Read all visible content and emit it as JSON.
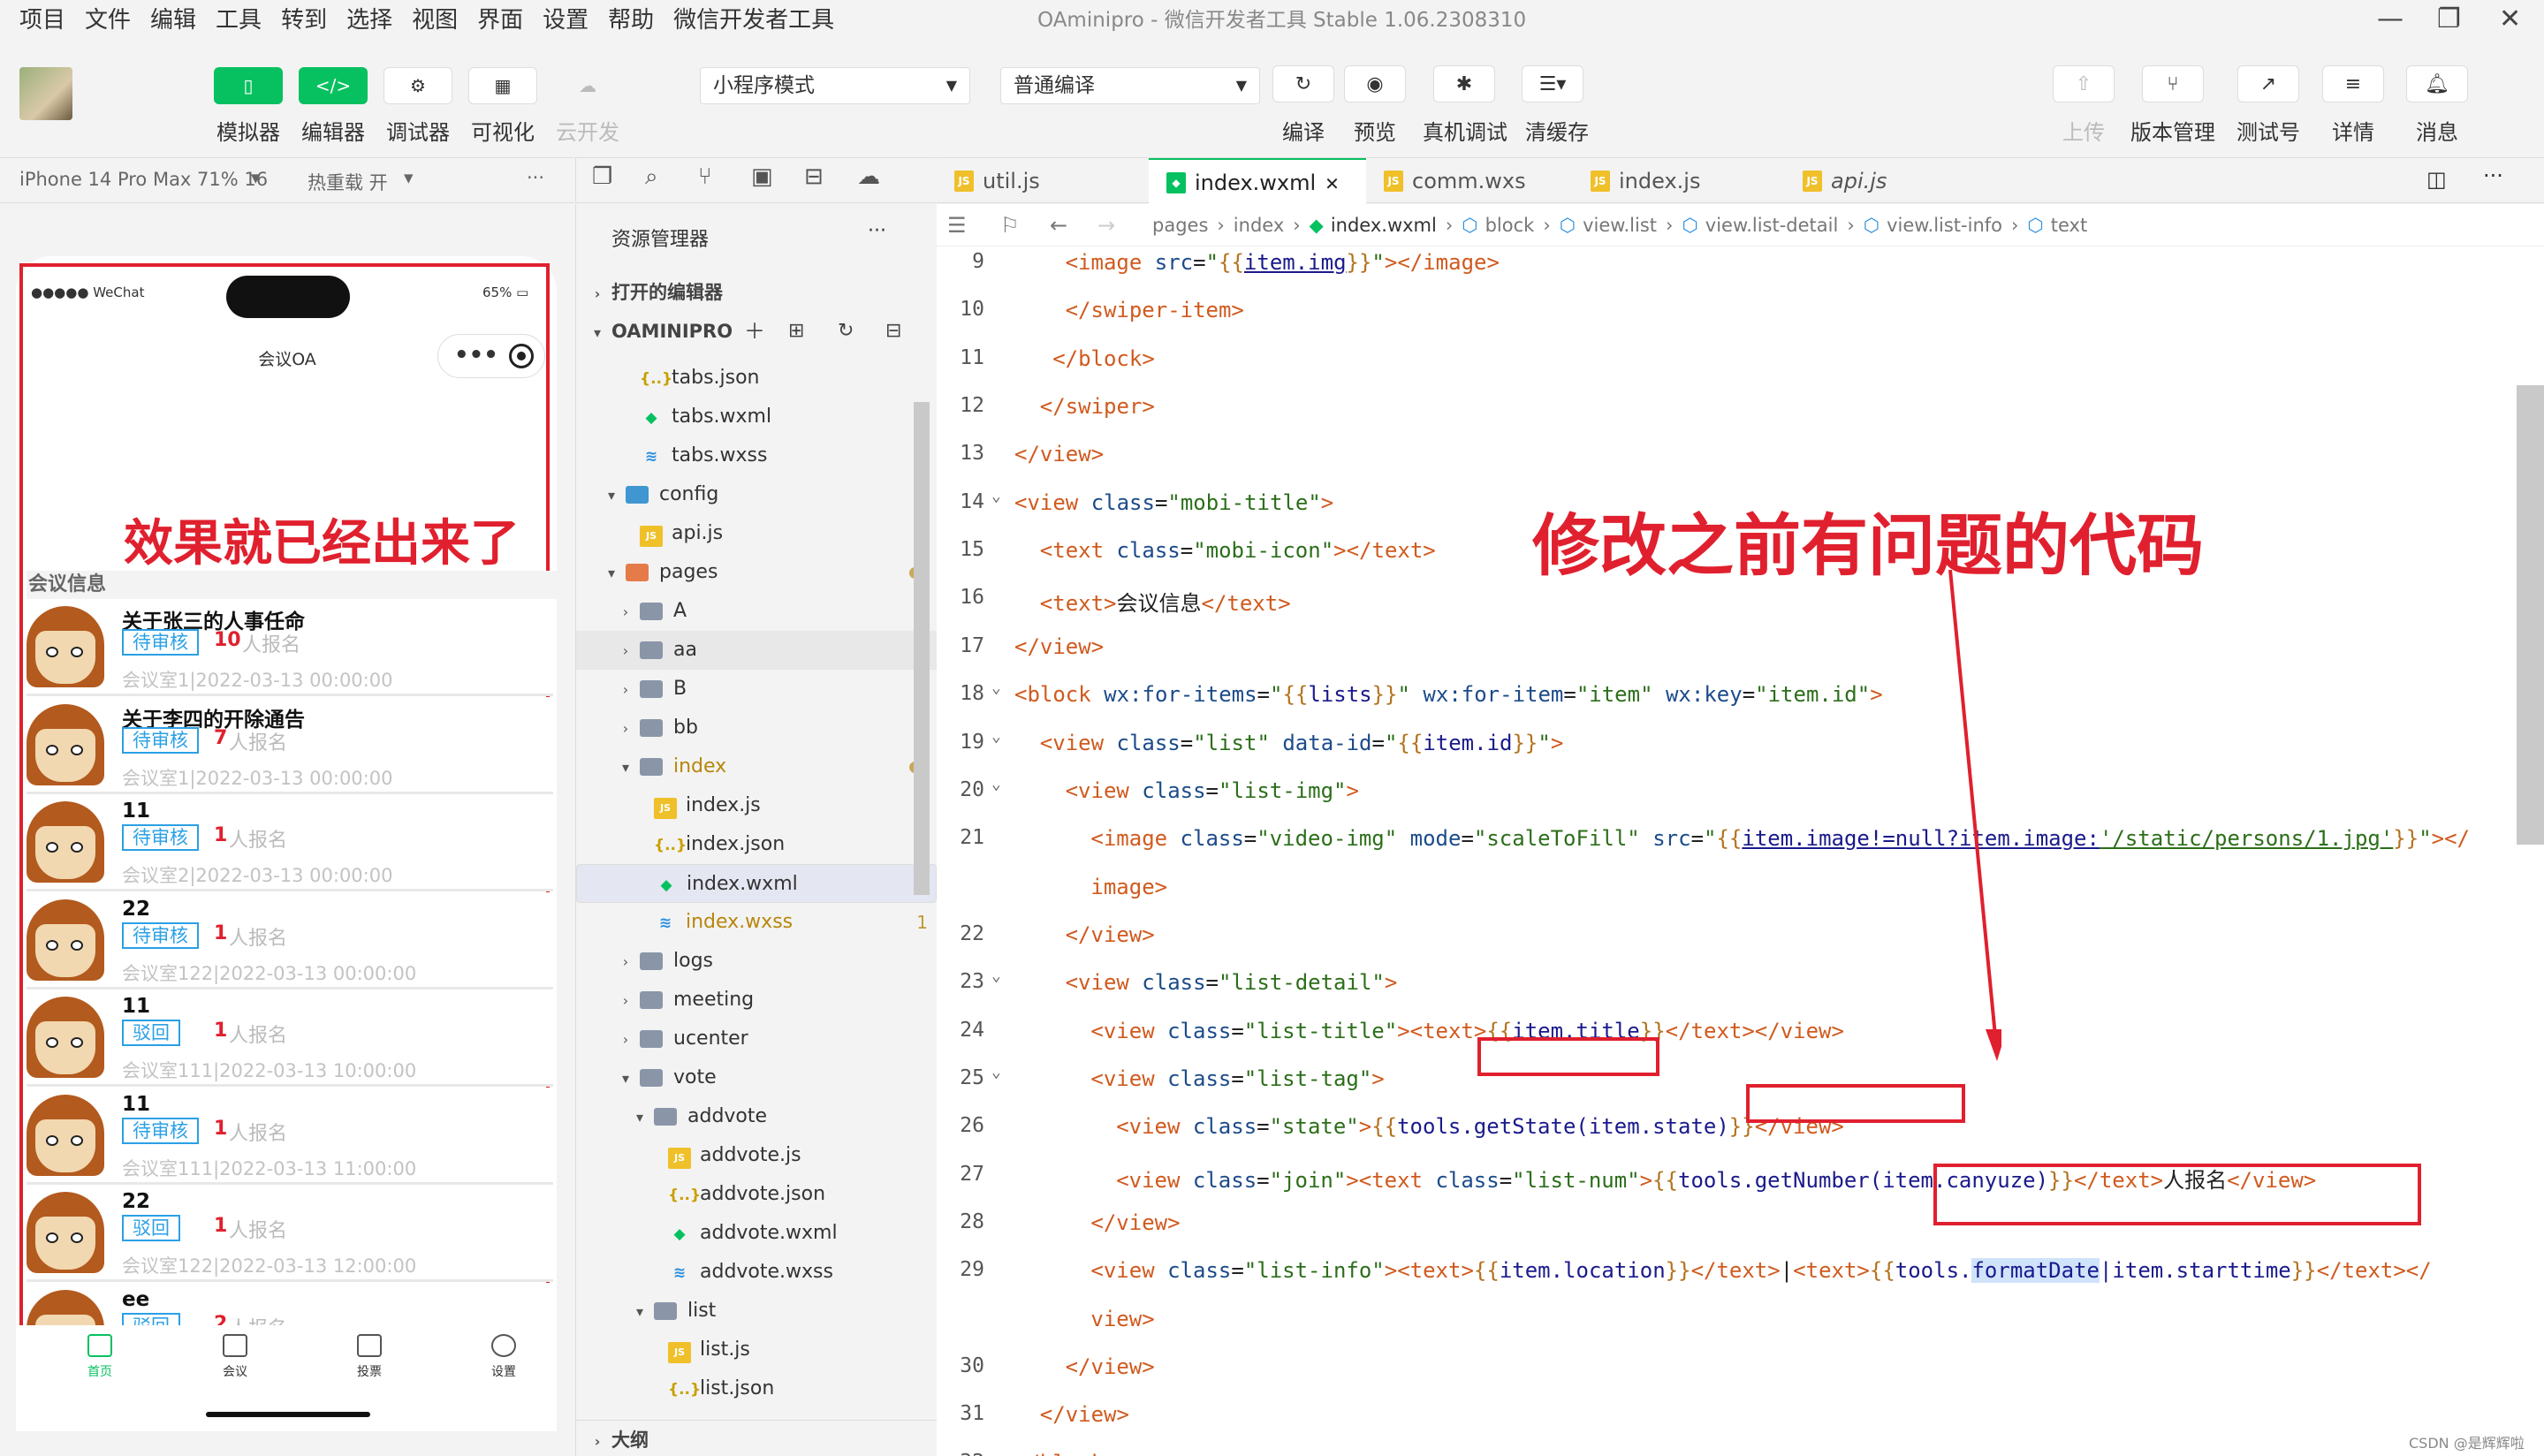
{
  "menu": [
    "项目",
    "文件",
    "编辑",
    "工具",
    "转到",
    "选择",
    "视图",
    "界面",
    "设置",
    "帮助",
    "微信开发者工具"
  ],
  "window_title": "OAminipro - 微信开发者工具 Stable 1.06.2308310",
  "toolbar": {
    "left": [
      {
        "label": "模拟器",
        "icon": "phone-icon"
      },
      {
        "label": "编辑器",
        "icon": "code-icon"
      },
      {
        "label": "调试器",
        "icon": "debug-icon"
      },
      {
        "label": "可视化",
        "icon": "layout-icon"
      },
      {
        "label": "云开发",
        "icon": "cloud-icon"
      }
    ],
    "mode": "小程序模式",
    "compile": "普通编译",
    "mid": [
      {
        "label": "编译",
        "icon": "refresh-icon"
      },
      {
        "label": "预览",
        "icon": "eye-icon"
      },
      {
        "label": "真机调试",
        "icon": "bug-icon"
      },
      {
        "label": "清缓存",
        "icon": "layers-icon"
      }
    ],
    "right": [
      {
        "label": "上传",
        "icon": "upload-icon"
      },
      {
        "label": "版本管理",
        "icon": "branch-icon"
      },
      {
        "label": "测试号",
        "icon": "external-icon"
      },
      {
        "label": "详情",
        "icon": "menu-icon"
      },
      {
        "label": "消息",
        "icon": "bell-icon"
      }
    ]
  },
  "simulator": {
    "device": "iPhone 14 Pro Max 71% 16",
    "hotreload": "热重载 开",
    "more": "···",
    "status_left": "●●●●● WeChat",
    "battery": "65%",
    "page_title": "会议OA",
    "annotation": "效果就已经出来了",
    "section": "会议信息",
    "meetings": [
      {
        "title": "关于张三的人事任命",
        "tag": "待审核",
        "num": "10",
        "sign": "人报名",
        "info": "会议室1|2022-03-13 00:00:00"
      },
      {
        "title": "关于李四的开除通告",
        "tag": "待审核",
        "num": "7",
        "sign": "人报名",
        "info": "会议室1|2022-03-13 00:00:00"
      },
      {
        "title": "11",
        "tag": "待审核",
        "num": "1",
        "sign": "人报名",
        "info": "会议室2|2022-03-13 00:00:00"
      },
      {
        "title": "22",
        "tag": "待审核",
        "num": "1",
        "sign": "人报名",
        "info": "会议室122|2022-03-13 00:00:00"
      },
      {
        "title": "11",
        "tag": "驳回",
        "num": "1",
        "sign": "人报名",
        "info": "会议室111|2022-03-13 10:00:00"
      },
      {
        "title": "11",
        "tag": "待审核",
        "num": "1",
        "sign": "人报名",
        "info": "会议室111|2022-03-13 11:00:00"
      },
      {
        "title": "22",
        "tag": "驳回",
        "num": "1",
        "sign": "人报名",
        "info": "会议室122|2022-03-13 12:00:00"
      },
      {
        "title": "ee",
        "tag": "驳回",
        "num": "2",
        "sign": "人报名",
        "info": ""
      }
    ],
    "tabs": [
      "首页",
      "会议",
      "投票",
      "设置"
    ]
  },
  "explorer": {
    "title": "资源管理器",
    "more": "···",
    "open_editors": "打开的编辑器",
    "project": "OAMINIPRO",
    "outline": "大纲",
    "items": [
      {
        "name": "tabs.json",
        "kind": "json",
        "indent": 2
      },
      {
        "name": "tabs.wxml",
        "kind": "wxml",
        "indent": 2
      },
      {
        "name": "tabs.wxss",
        "kind": "wxss",
        "indent": 2
      },
      {
        "name": "config",
        "kind": "folder-blue",
        "indent": 1,
        "arrow": "▾"
      },
      {
        "name": "api.js",
        "kind": "js",
        "indent": 2
      },
      {
        "name": "pages",
        "kind": "folder-orange",
        "indent": 1,
        "arrow": "▾",
        "dot": true
      },
      {
        "name": "A",
        "kind": "folder",
        "indent": 2,
        "arrow": "›"
      },
      {
        "name": "aa",
        "kind": "folder",
        "indent": 2,
        "arrow": "›",
        "hover": true
      },
      {
        "name": "B",
        "kind": "folder",
        "indent": 2,
        "arrow": "›"
      },
      {
        "name": "bb",
        "kind": "folder",
        "indent": 2,
        "arrow": "›"
      },
      {
        "name": "index",
        "kind": "folder",
        "indent": 2,
        "arrow": "▾",
        "dot": true,
        "orange": true
      },
      {
        "name": "index.js",
        "kind": "js",
        "indent": 3
      },
      {
        "name": "index.json",
        "kind": "json",
        "indent": 3
      },
      {
        "name": "index.wxml",
        "kind": "wxml",
        "indent": 3,
        "selected": true
      },
      {
        "name": "index.wxss",
        "kind": "wxss",
        "indent": 3,
        "err": "1",
        "orange": true
      },
      {
        "name": "logs",
        "kind": "folder",
        "indent": 2,
        "arrow": "›"
      },
      {
        "name": "meeting",
        "kind": "folder",
        "indent": 2,
        "arrow": "›"
      },
      {
        "name": "ucenter",
        "kind": "folder",
        "indent": 2,
        "arrow": "›"
      },
      {
        "name": "vote",
        "kind": "folder",
        "indent": 2,
        "arrow": "▾"
      },
      {
        "name": "addvote",
        "kind": "folder",
        "indent": 3,
        "arrow": "▾"
      },
      {
        "name": "addvote.js",
        "kind": "js",
        "indent": 4
      },
      {
        "name": "addvote.json",
        "kind": "json",
        "indent": 4
      },
      {
        "name": "addvote.wxml",
        "kind": "wxml",
        "indent": 4
      },
      {
        "name": "addvote.wxss",
        "kind": "wxss",
        "indent": 4
      },
      {
        "name": "list",
        "kind": "folder",
        "indent": 3,
        "arrow": "▾"
      },
      {
        "name": "list.js",
        "kind": "js",
        "indent": 4
      },
      {
        "name": "list.json",
        "kind": "json",
        "indent": 4
      }
    ]
  },
  "editor": {
    "tabs": [
      {
        "name": "util.js",
        "kind": "js"
      },
      {
        "name": "index.wxml",
        "kind": "wxml",
        "active": true,
        "close": "✕"
      },
      {
        "name": "comm.wxs",
        "kind": "js"
      },
      {
        "name": "index.js",
        "kind": "js"
      },
      {
        "name": "api.js",
        "kind": "js",
        "italic": true
      }
    ],
    "breadcrumb": [
      "pages",
      "index",
      "index.wxml",
      "block",
      "view.list",
      "view.list-detail",
      "view.list-info",
      "text"
    ],
    "annotation": "修改之前有问题的代码",
    "watermark": "CSDN @是辉辉啦"
  }
}
